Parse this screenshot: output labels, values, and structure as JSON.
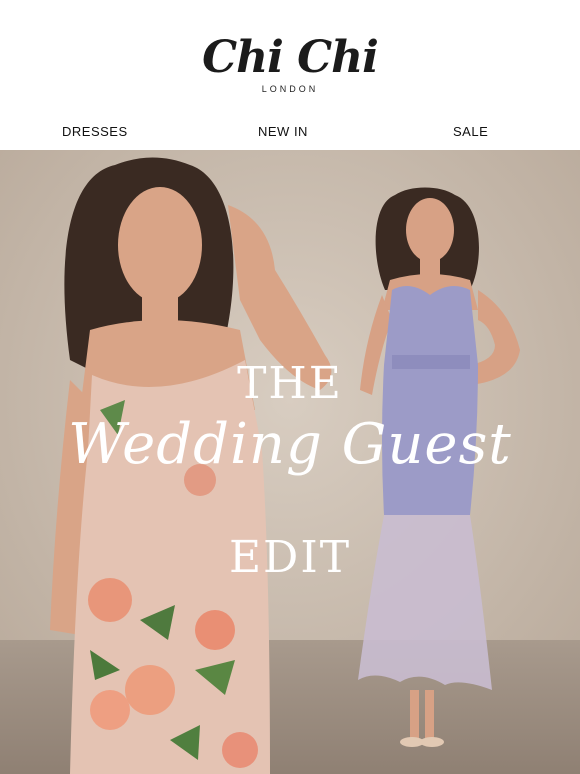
{
  "brand": {
    "name": "Chi Chi",
    "location": "LONDON"
  },
  "nav": {
    "items": [
      "DRESSES",
      "NEW IN",
      "SALE"
    ]
  },
  "hero": {
    "line1": "THE",
    "line2": "Wedding Guest",
    "line3": "EDIT"
  },
  "colors": {
    "background_studio": "#cfc3b6",
    "floor": "#a8998c",
    "dress_left": "#e3c2b3",
    "dress_right": "#9d9cc9",
    "skin": "#d9a487",
    "hair": "#3a2a22"
  }
}
